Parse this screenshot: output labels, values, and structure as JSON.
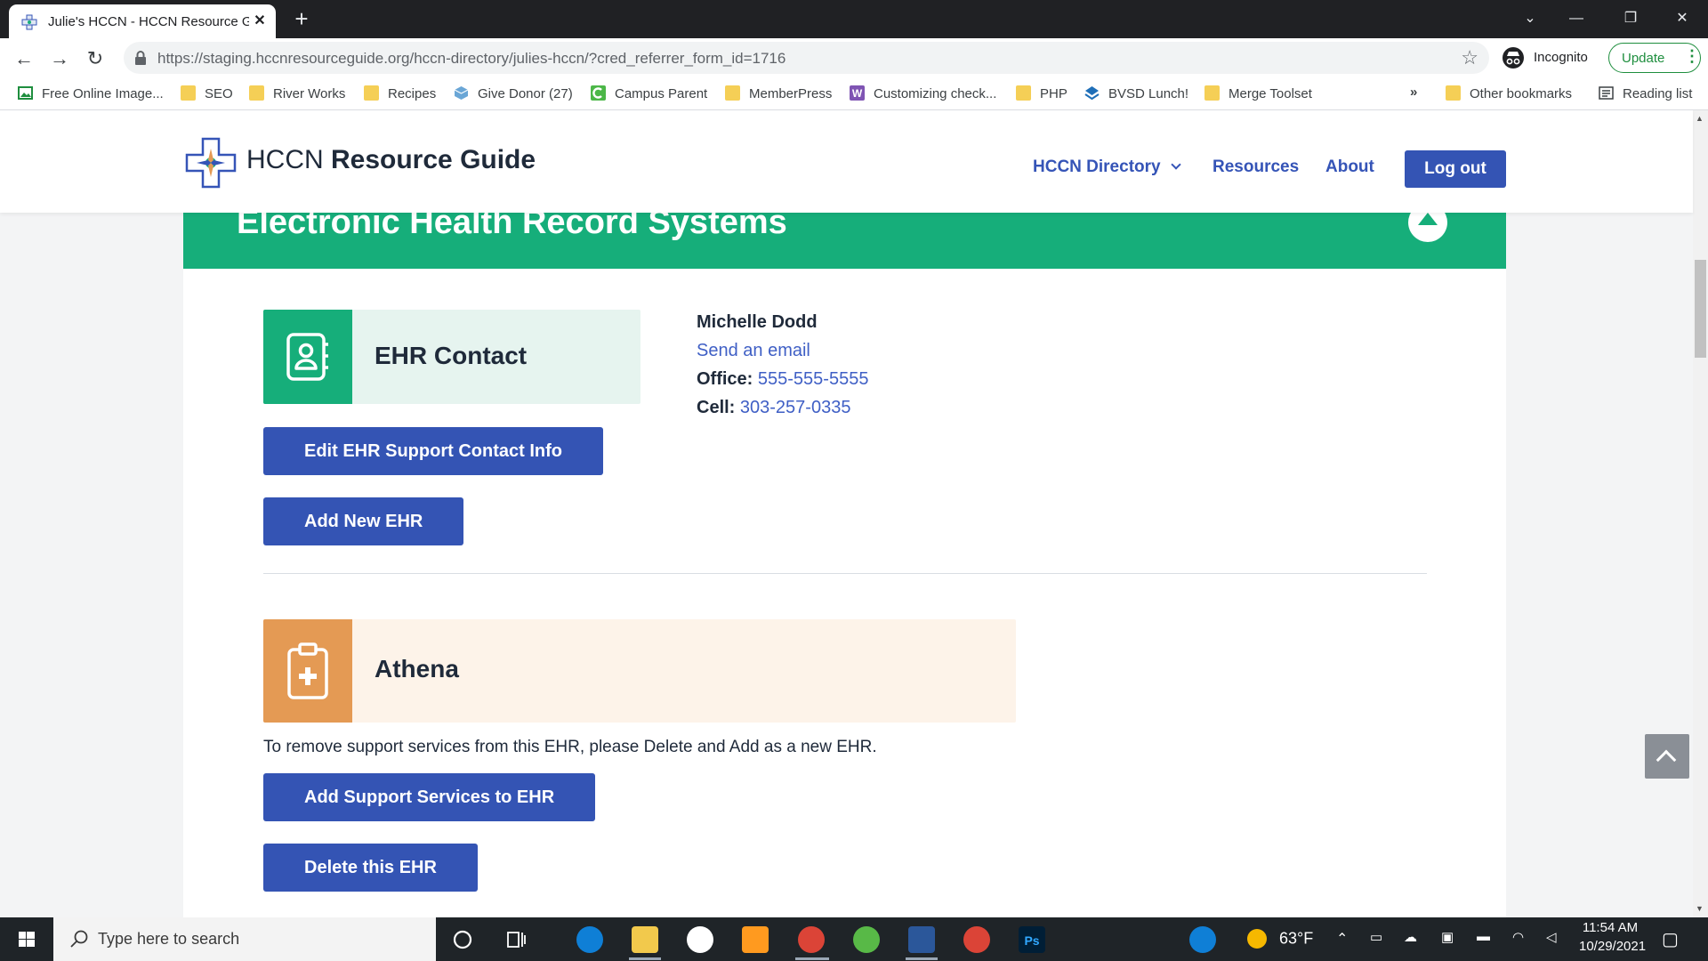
{
  "browser": {
    "tab_title": "Julie's HCCN - HCCN Resource G",
    "tab_close": "✕",
    "new_tab": "+",
    "url": "https://staging.hccnresourceguide.org/hccn-directory/julies-hccn/?cred_referrer_form_id=1716",
    "incognito_label": "Incognito",
    "update_label": "Update",
    "bookmarks": [
      {
        "label": "Free Online Image...",
        "icon": "image-icon"
      },
      {
        "label": "SEO",
        "icon": "folder-icon"
      },
      {
        "label": "River Works",
        "icon": "folder-icon"
      },
      {
        "label": "Recipes",
        "icon": "folder-icon"
      },
      {
        "label": "Give Donor (27)",
        "icon": "cube-icon"
      },
      {
        "label": "Campus Parent",
        "icon": "campus-icon"
      },
      {
        "label": "MemberPress",
        "icon": "folder-icon"
      },
      {
        "label": "Customizing check...",
        "icon": "woo-icon"
      },
      {
        "label": "PHP",
        "icon": "folder-icon"
      },
      {
        "label": "BVSD Lunch!",
        "icon": "layers-icon"
      },
      {
        "label": "Merge Toolset",
        "icon": "folder-icon"
      }
    ],
    "bookmarks_more": "»",
    "other_bookmarks": "Other bookmarks",
    "reading_list": "Reading list"
  },
  "site": {
    "logo_light": "HCCN ",
    "logo_bold": "Resource Guide",
    "nav": {
      "directory": "HCCN Directory",
      "resources": "Resources",
      "about": "About",
      "logout": "Log out"
    }
  },
  "section": {
    "title": "Electronic Health Record Systems",
    "contact_card_title": "EHR Contact",
    "contact": {
      "name": "Michelle Dodd",
      "email_link": "Send an email",
      "office_label": "Office:",
      "office_value": "555-555-5555",
      "cell_label": "Cell:",
      "cell_value": "303-257-0335"
    },
    "edit_contact_button": "Edit EHR Support Contact Info",
    "add_ehr_button": "Add New EHR",
    "ehr_card_title": "Athena",
    "remove_note": "To remove support services from this EHR, please Delete and Add as a new EHR.",
    "add_support_button": "Add Support Services to EHR",
    "delete_button": "Delete this EHR"
  },
  "taskbar": {
    "search_placeholder": "Type here to search",
    "weather": "63°F",
    "time": "11:54 AM",
    "date": "10/29/2021"
  },
  "colors": {
    "green": "#16ae7a",
    "green_light": "#e6f4ef",
    "orange": "#e49a54",
    "orange_light": "#fdf3e9",
    "button_blue": "#3454b4",
    "link_blue": "#3f5fc5"
  }
}
